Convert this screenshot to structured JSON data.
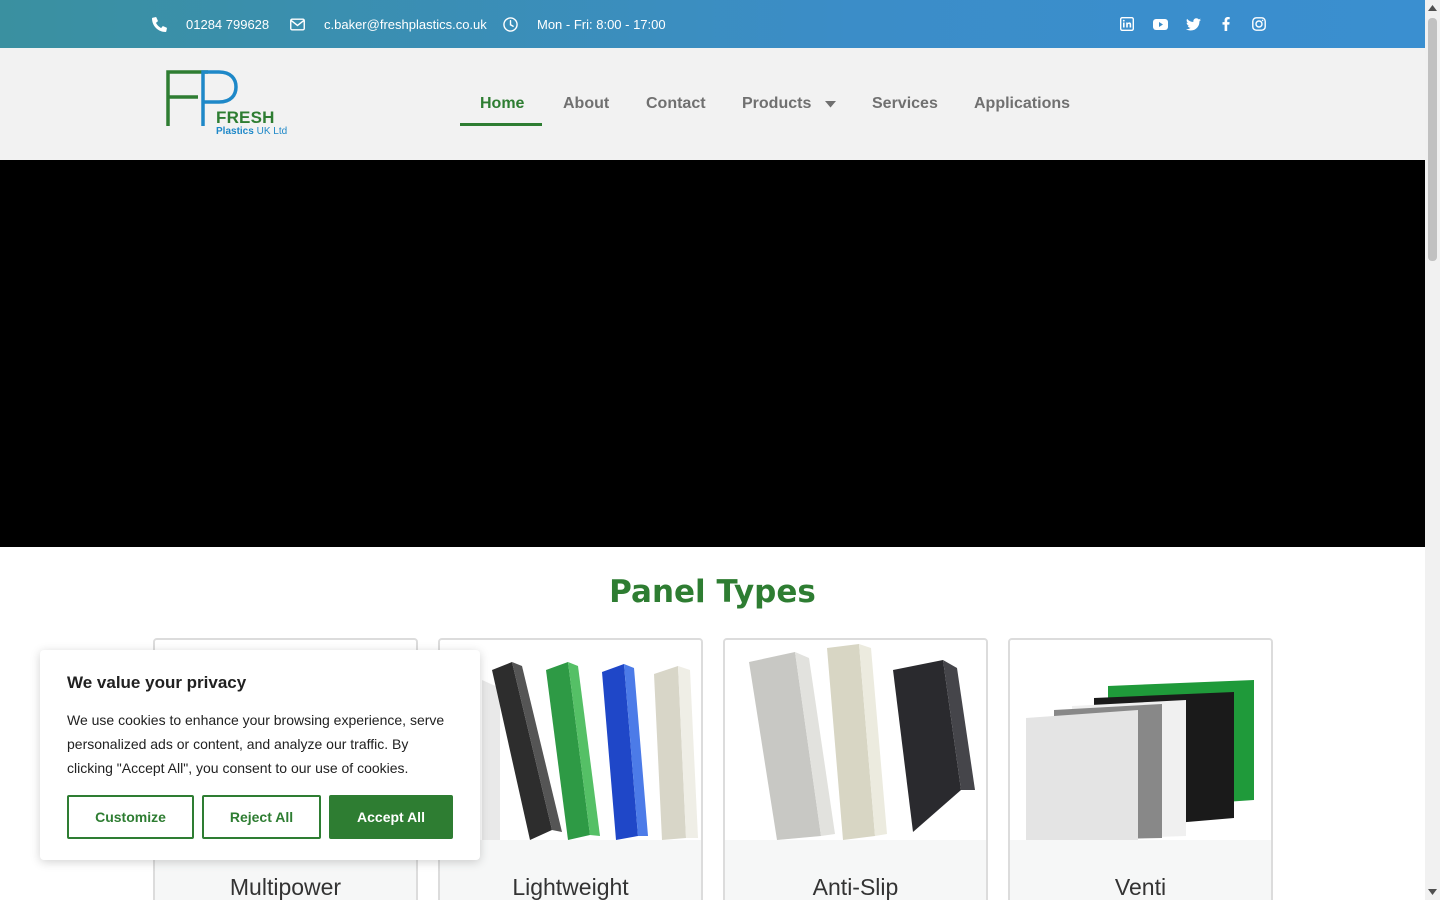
{
  "topbar": {
    "phone": "01284 799628",
    "email": "c.baker@freshplastics.co.uk",
    "hours": "Mon - Fri: 8:00 - 17:00",
    "social_icons": [
      "linkedin-icon",
      "youtube-icon",
      "twitter-icon",
      "facebook-icon",
      "instagram-icon"
    ]
  },
  "header": {
    "logo": {
      "fresh": "FRESH",
      "plastics": "Plastics",
      "uk_ltd": "UK Ltd"
    },
    "nav": [
      {
        "label": "Home",
        "active": true
      },
      {
        "label": "About"
      },
      {
        "label": "Contact"
      },
      {
        "label": "Products",
        "dropdown": true
      },
      {
        "label": "Services"
      },
      {
        "label": "Applications"
      }
    ]
  },
  "section": {
    "title": "Panel Types"
  },
  "cards": [
    {
      "title": "Multipower"
    },
    {
      "title": "Lightweight"
    },
    {
      "title": "Anti-Slip"
    },
    {
      "title": "Venti"
    }
  ],
  "cookie": {
    "title": "We value your privacy",
    "text": "We use cookies to enhance your browsing experience, serve personalized ads or content, and analyze our traffic. By clicking \"Accept All\", you consent to our use of cookies.",
    "customize": "Customize",
    "reject": "Reject All",
    "accept": "Accept All"
  },
  "colors": {
    "brand_green": "#2e7d32",
    "topbar_blue": "#3b8dc8",
    "nav_grey": "#707070"
  }
}
